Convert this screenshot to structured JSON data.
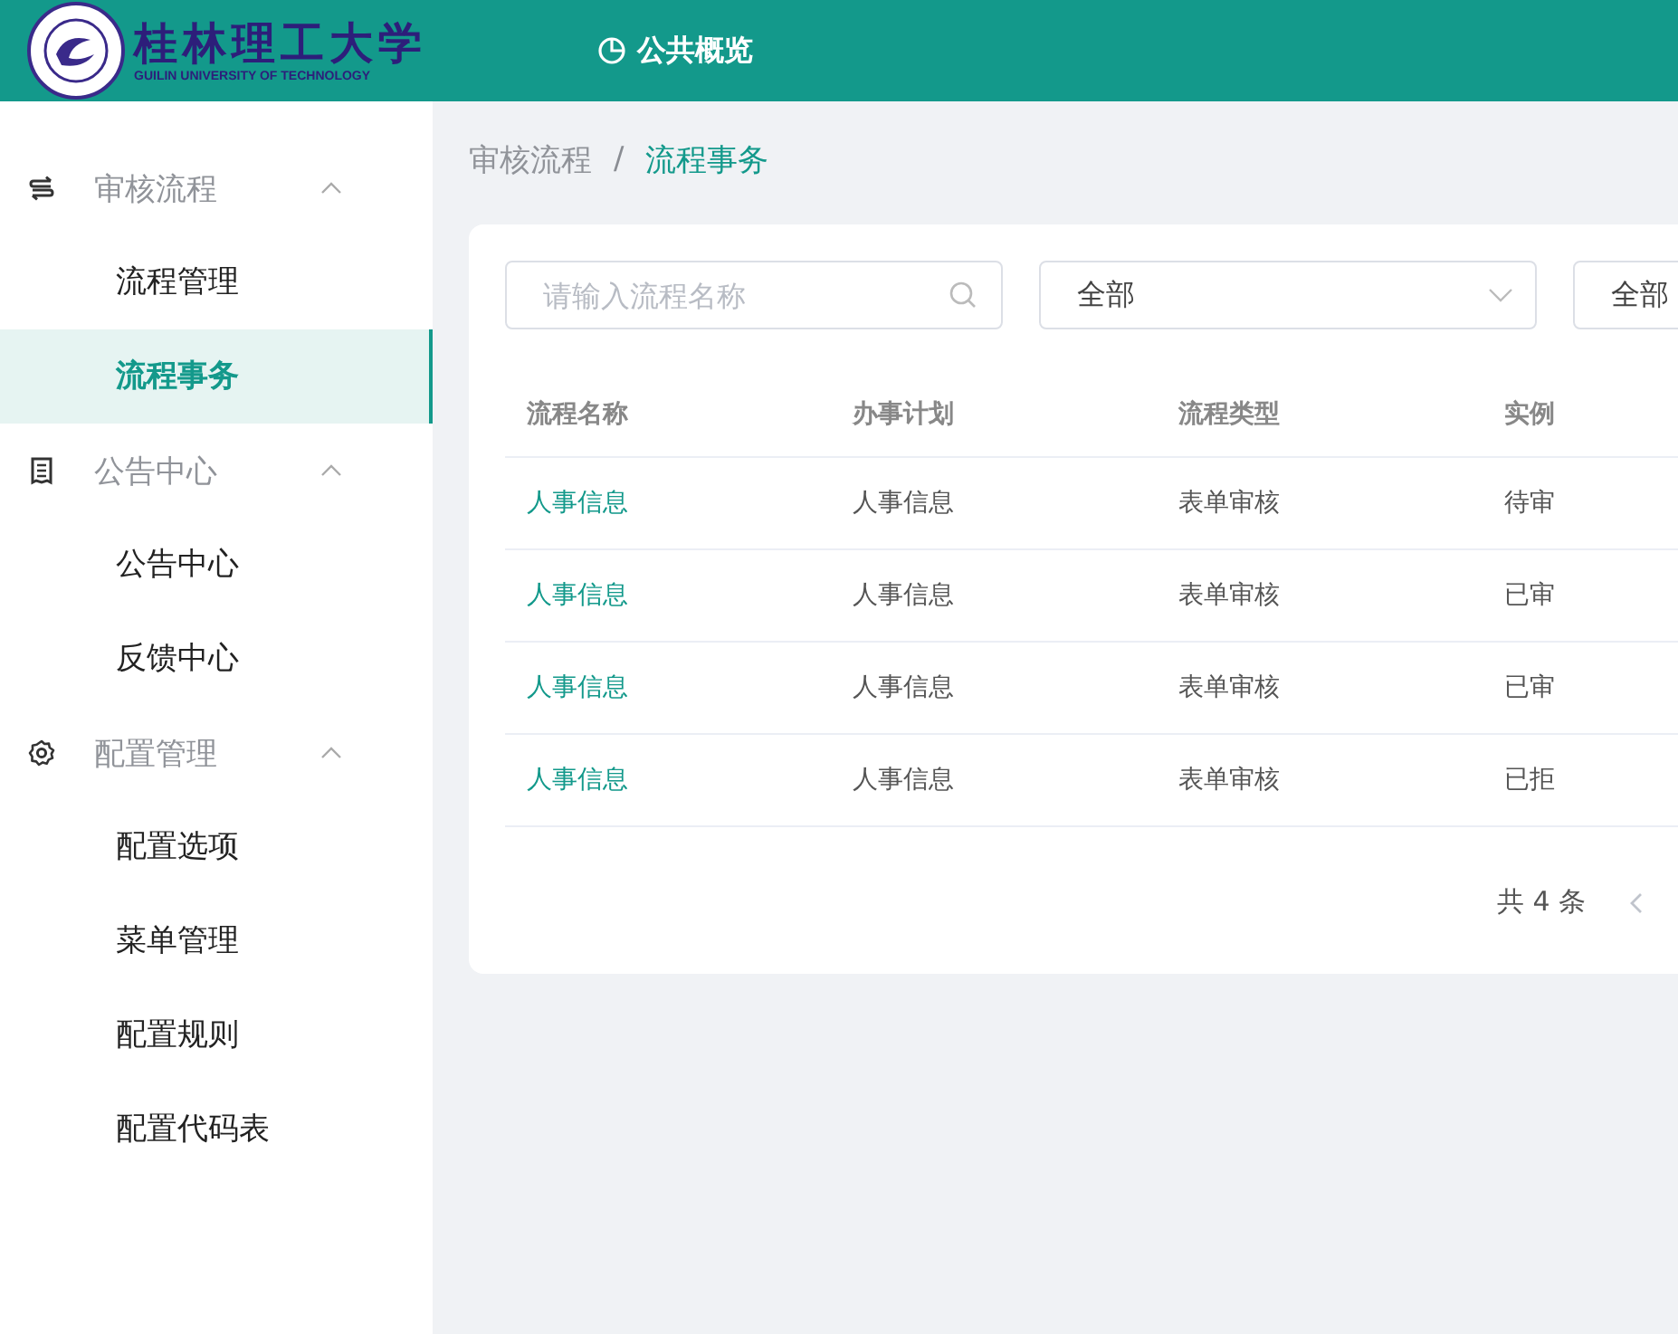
{
  "header": {
    "logo_title": "桂林理工大学",
    "logo_subtitle": "GUILIN UNIVERSITY OF TECHNOLOGY",
    "nav_item": "公共概览"
  },
  "sidebar": {
    "groups": [
      {
        "label": "审核流程",
        "kind": "swap",
        "expanded": true,
        "items": [
          {
            "label": "流程管理",
            "selected": false
          },
          {
            "label": "流程事务",
            "selected": true
          }
        ]
      },
      {
        "label": "公告中心",
        "kind": "doc",
        "expanded": true,
        "items": [
          {
            "label": "公告中心",
            "selected": false
          },
          {
            "label": "反馈中心",
            "selected": false
          }
        ]
      },
      {
        "label": "配置管理",
        "kind": "gear",
        "expanded": true,
        "items": [
          {
            "label": "配置选项",
            "selected": false
          },
          {
            "label": "菜单管理",
            "selected": false
          },
          {
            "label": "配置规则",
            "selected": false
          },
          {
            "label": "配置代码表",
            "selected": false
          }
        ]
      }
    ]
  },
  "breadcrumb": [
    "审核流程",
    "流程事务"
  ],
  "breadcrumb_separator": "/",
  "filters": {
    "search": {
      "placeholder": "请输入流程名称"
    },
    "selects": [
      "全部",
      "全部"
    ]
  },
  "table": {
    "columns": [
      "流程名称",
      "办事计划",
      "流程类型",
      "实例"
    ],
    "rows": [
      [
        "人事信息",
        "人事信息",
        "表单审核",
        "待审"
      ],
      [
        "人事信息",
        "人事信息",
        "表单审核",
        "已审"
      ],
      [
        "人事信息",
        "人事信息",
        "表单审核",
        "已审"
      ],
      [
        "人事信息",
        "人事信息",
        "表单审核",
        "已拒"
      ]
    ]
  },
  "pagination": {
    "total": "共 4 条"
  }
}
